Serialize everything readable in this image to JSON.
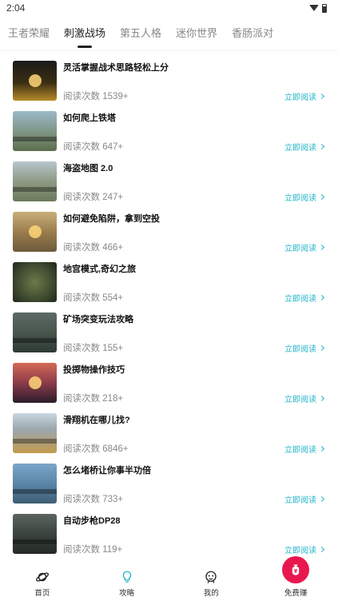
{
  "status_bar": {
    "time": "2:04"
  },
  "tabs": [
    {
      "label": "王者荣耀",
      "active": false
    },
    {
      "label": "刺激战场",
      "active": true
    },
    {
      "label": "第五人格",
      "active": false
    },
    {
      "label": "迷你世界",
      "active": false
    },
    {
      "label": "香肠派对",
      "active": false
    }
  ],
  "articles": [
    {
      "title": "灵活掌握战术思路轻松上分",
      "reads": "阅读次数 1539+",
      "action": "立即阅读"
    },
    {
      "title": "如何爬上铁塔",
      "reads": "阅读次数 647+",
      "action": "立即阅读"
    },
    {
      "title": "海盗地图 2.0",
      "reads": "阅读次数 247+",
      "action": "立即阅读"
    },
    {
      "title": "如何避免陷阱，拿到空投",
      "reads": "阅读次数 466+",
      "action": "立即阅读"
    },
    {
      "title": "地宫模式,奇幻之旅",
      "reads": "阅读次数 554+",
      "action": "立即阅读"
    },
    {
      "title": "矿场突变玩法攻略",
      "reads": "阅读次数 155+",
      "action": "立即阅读"
    },
    {
      "title": "投掷物操作技巧",
      "reads": "阅读次数 218+",
      "action": "立即阅读"
    },
    {
      "title": "滑翔机在哪儿找?",
      "reads": "阅读次数 6846+",
      "action": "立即阅读"
    },
    {
      "title": "怎么堵桥让你事半功倍",
      "reads": "阅读次数 733+",
      "action": "立即阅读"
    },
    {
      "title": "自动步枪DP28",
      "reads": "阅读次数 119+",
      "action": "立即阅读"
    }
  ],
  "bottom_nav": [
    {
      "label": "首页",
      "icon": "planet-icon"
    },
    {
      "label": "攻略",
      "icon": "lightbulb-icon",
      "active": true
    },
    {
      "label": "我的",
      "icon": "user-face-icon"
    },
    {
      "label": "免费赚",
      "icon": "money-bag-icon"
    }
  ],
  "colors": {
    "accent": "#21b6c9",
    "earn": "#e8184e"
  }
}
